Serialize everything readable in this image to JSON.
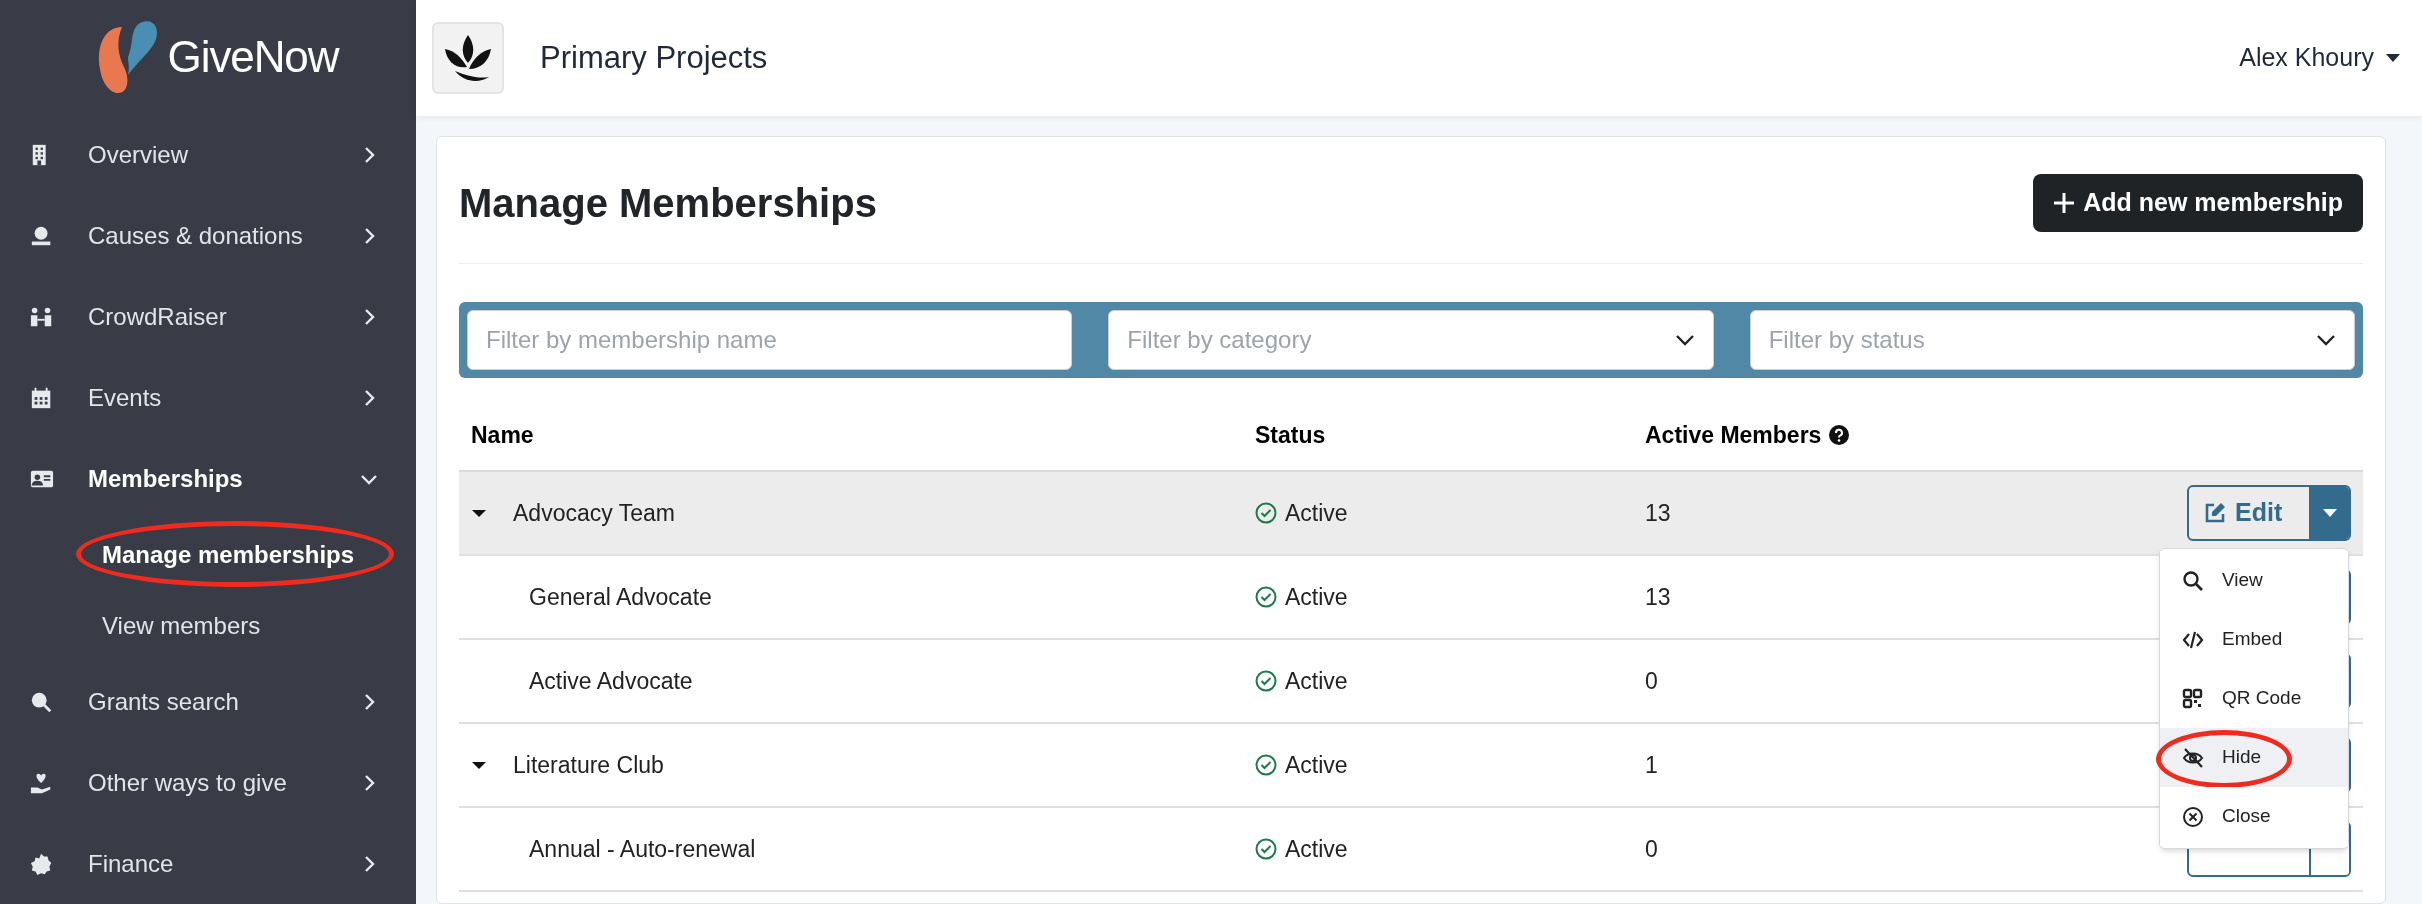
{
  "brand": {
    "name": "**Give**Now"
  },
  "sidebar": {
    "items": [
      {
        "label": "Overview",
        "selected": false,
        "expanded": false
      },
      {
        "label": "Causes & donations",
        "selected": false,
        "expanded": false
      },
      {
        "label": "CrowdRaiser",
        "selected": false,
        "expanded": false
      },
      {
        "label": "Events",
        "selected": false,
        "expanded": false
      },
      {
        "label": "Memberships",
        "selected": true,
        "expanded": true,
        "children": [
          {
            "label": "Manage memberships",
            "selected": true,
            "circled": true
          },
          {
            "label": "View members",
            "selected": false,
            "circled": false
          }
        ]
      },
      {
        "label": "Grants search",
        "selected": false,
        "expanded": false
      },
      {
        "label": "Other ways to give",
        "selected": false,
        "expanded": false
      },
      {
        "label": "Finance",
        "selected": false,
        "expanded": false
      }
    ]
  },
  "header": {
    "org_name": "Primary Projects",
    "user": "Alex Khoury"
  },
  "page": {
    "title": "Manage Memberships",
    "add_button": "Add new membership"
  },
  "filters": [
    {
      "kind": "text",
      "placeholder": "Filter by membership name"
    },
    {
      "kind": "select",
      "placeholder": "Filter by category"
    },
    {
      "kind": "select",
      "placeholder": "Filter by status"
    }
  ],
  "table": {
    "columns": [
      {
        "label": "Name",
        "help": false
      },
      {
        "label": "Status",
        "help": false
      },
      {
        "label": "Active Members",
        "help": true
      }
    ],
    "rows": [
      {
        "name": "Advocacy Team",
        "status": "Active",
        "members": "13",
        "highlighted": true,
        "expanded": true,
        "has_button": true,
        "action": "Edit",
        "menu_open": true,
        "children": [
          {
            "name": "General Advocate",
            "status": "Active",
            "members": "13",
            "highlighted": false,
            "has_button": true
          },
          {
            "name": "Active Advocate",
            "status": "Active",
            "members": "0",
            "highlighted": false,
            "has_button": true
          }
        ]
      },
      {
        "name": "Literature Club",
        "status": "Active",
        "members": "1",
        "highlighted": false,
        "expanded": true,
        "has_button": true,
        "children": [
          {
            "name": "Annual - Auto-renewal",
            "status": "Active",
            "members": "0",
            "highlighted": false,
            "has_button": true
          }
        ]
      }
    ]
  },
  "action_menu": {
    "items": [
      {
        "label": "View",
        "highlighted": false,
        "circled": false
      },
      {
        "label": "Embed",
        "highlighted": false,
        "circled": false
      },
      {
        "label": "QR Code",
        "highlighted": false,
        "circled": false
      },
      {
        "label": "Hide",
        "highlighted": true,
        "circled": true
      },
      {
        "label": "Close",
        "highlighted": false,
        "circled": false
      }
    ]
  }
}
